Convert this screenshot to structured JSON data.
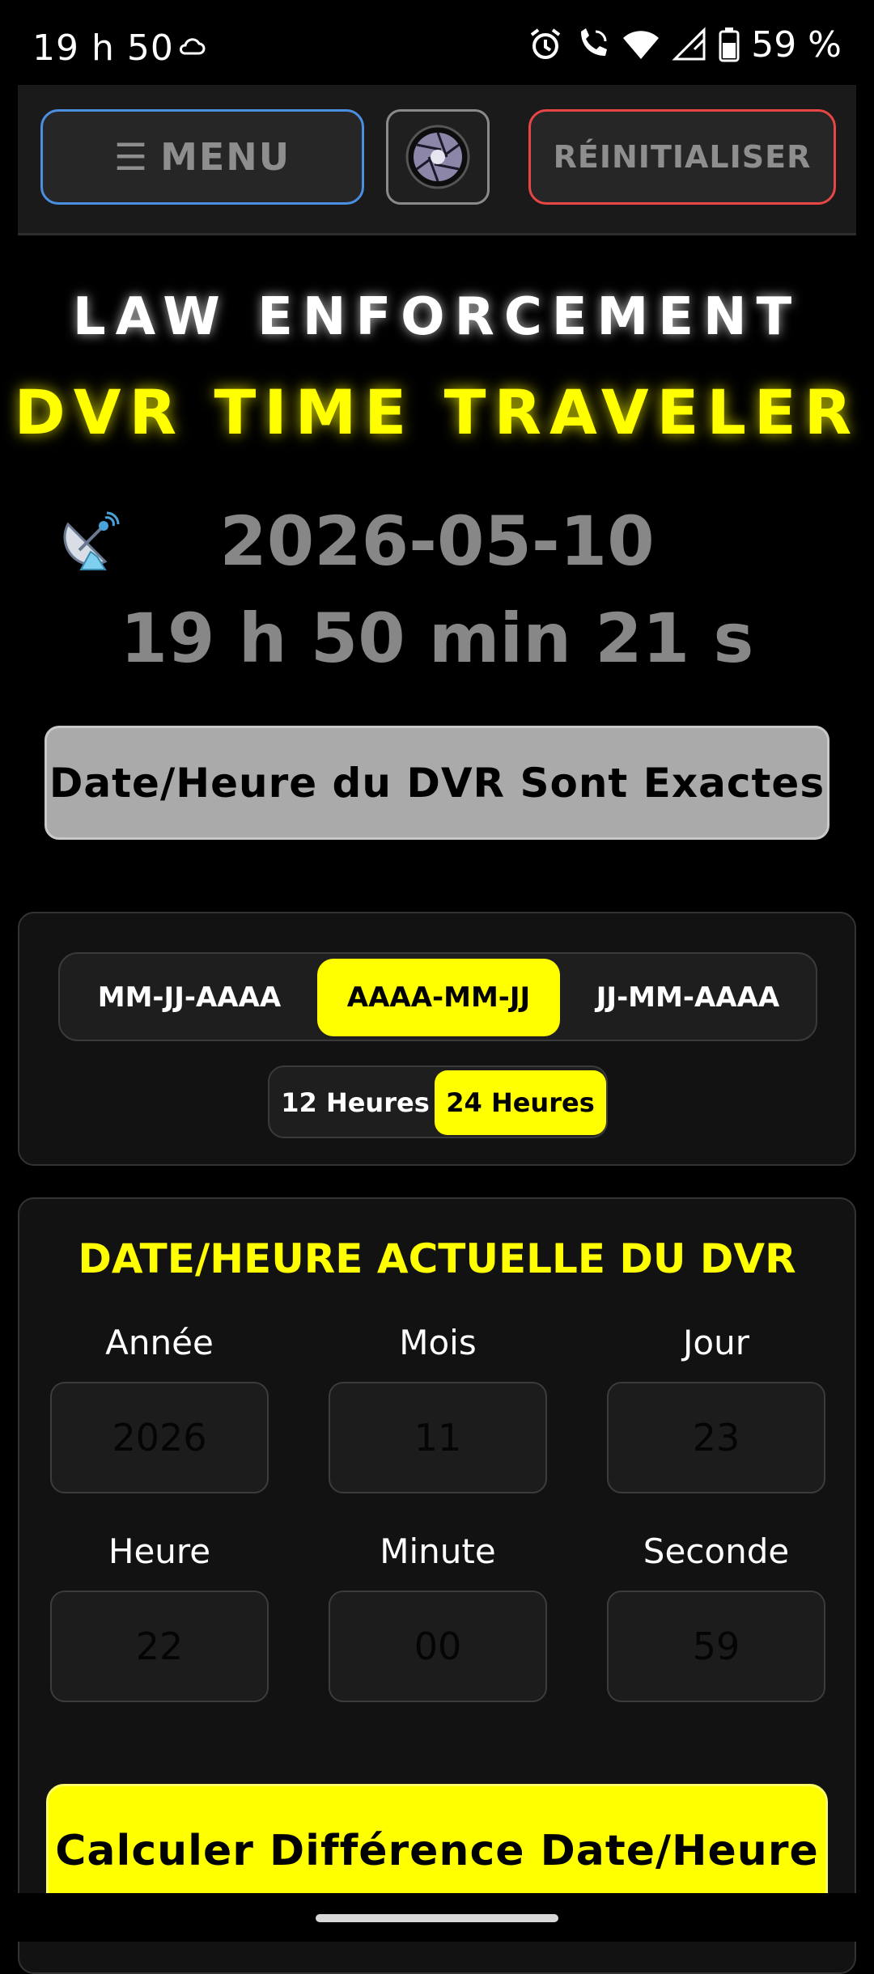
{
  "status_bar": {
    "time": "19 h 50",
    "battery": "59 %",
    "icons": [
      "cloud-icon",
      "alarm-icon",
      "phone-wifi-icon",
      "wifi-icon",
      "signal-icon",
      "battery-icon"
    ]
  },
  "toolbar": {
    "menu_label": "MENU",
    "reset_label": "RÉINITIALISER"
  },
  "header": {
    "title_line1": "LAW ENFORCEMENT",
    "title_line2": "DVR TIME TRAVELER"
  },
  "clock": {
    "date": "2026-05-10",
    "time": "19 h 50 min 21 s"
  },
  "exact_button": "Date/Heure du DVR Sont Exactes",
  "date_formats": {
    "options": [
      "MM-JJ-AAAA",
      "AAAA-MM-JJ",
      "JJ-MM-AAAA"
    ],
    "selected": "AAAA-MM-JJ"
  },
  "hour_formats": {
    "options": [
      "12 Heures",
      "24 Heures"
    ],
    "selected": "24 Heures"
  },
  "dvr": {
    "title": "DATE/HEURE ACTUELLE DU DVR",
    "fields": [
      {
        "label": "Année",
        "placeholder": "2026"
      },
      {
        "label": "Mois",
        "placeholder": "11"
      },
      {
        "label": "Jour",
        "placeholder": "23"
      },
      {
        "label": "Heure",
        "placeholder": "22"
      },
      {
        "label": "Minute",
        "placeholder": "00"
      },
      {
        "label": "Seconde",
        "placeholder": "59"
      }
    ],
    "calc_button": "Calculer Différence Date/Heure"
  },
  "colors": {
    "accent_yellow": "#ffff00",
    "menu_border": "#4a8fe0",
    "reset_border": "#e84545"
  }
}
